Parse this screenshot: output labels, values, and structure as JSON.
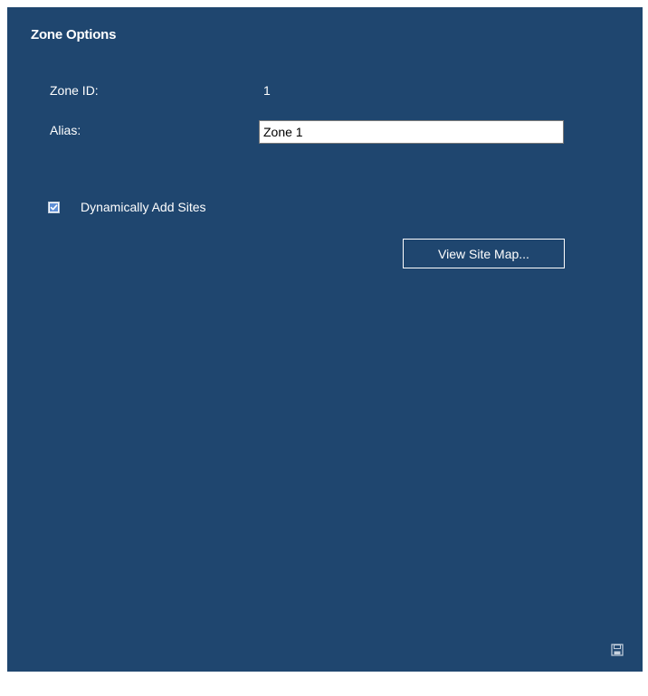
{
  "panel": {
    "title": "Zone Options"
  },
  "zone_id": {
    "label": "Zone ID:",
    "value": "1"
  },
  "alias": {
    "label": "Alias:",
    "value": "Zone 1"
  },
  "dynamic_sites": {
    "label": "Dynamically Add Sites",
    "checked": true
  },
  "buttons": {
    "view_site_map": "View Site Map..."
  },
  "icons": {
    "save": "save-icon",
    "checkbox_check": "check-icon"
  },
  "colors": {
    "panel_bg": "#1f466f",
    "checkbox_fill": "#5f8fd6"
  }
}
